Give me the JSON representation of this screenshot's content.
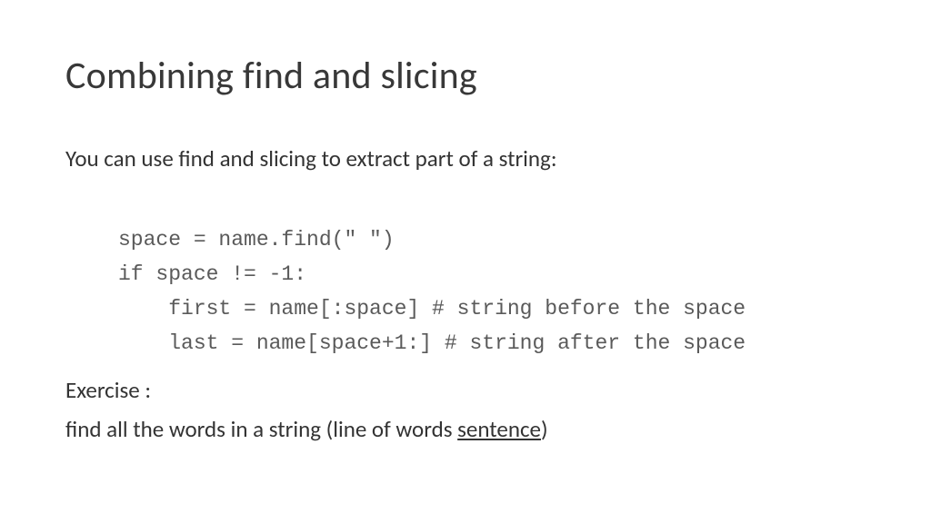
{
  "title": "Combining find and slicing",
  "intro": "You can use find and slicing to extract part of a string:",
  "code": {
    "line1": "space = name.find(\" \")",
    "line2": "if space != -1:",
    "line3": "    first = name[:space] # string before the space",
    "line4": "    last = name[space+1:] # string after the space"
  },
  "exercise_label": "Exercise :",
  "exercise_prefix": "find all the words in a string (line of words ",
  "exercise_underlined": "sentence",
  "exercise_suffix": ")"
}
